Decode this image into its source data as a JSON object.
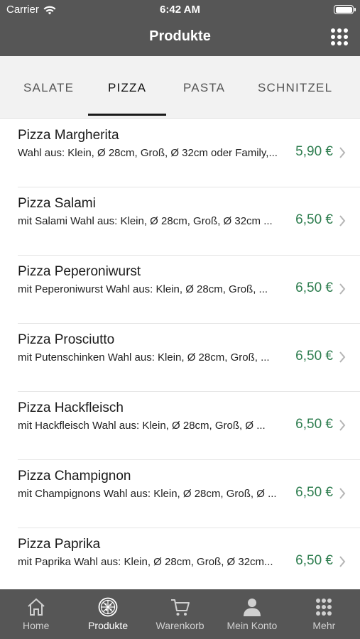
{
  "status": {
    "carrier": "Carrier",
    "time": "6:42 AM"
  },
  "nav": {
    "title": "Produkte",
    "menu_icon": "grid-icon"
  },
  "tabs": [
    {
      "label": "SALATE",
      "active": false
    },
    {
      "label": "PIZZA",
      "active": true
    },
    {
      "label": "PASTA",
      "active": false
    },
    {
      "label": "SCHNITZEL",
      "active": false
    }
  ],
  "items": [
    {
      "title": "Pizza Margherita",
      "desc": "Wahl aus: Klein, Ø 28cm, Groß, Ø 32cm oder Family,...",
      "price": "5,90 €"
    },
    {
      "title": "Pizza Salami",
      "desc": "mit Salami Wahl aus: Klein, Ø 28cm, Groß, Ø 32cm ...",
      "price": "6,50 €"
    },
    {
      "title": "Pizza Peperoniwurst",
      "desc": "mit Peperoniwurst Wahl aus: Klein, Ø 28cm, Groß, ...",
      "price": "6,50 €"
    },
    {
      "title": "Pizza Prosciutto",
      "desc": "mit Putenschinken Wahl aus: Klein, Ø 28cm, Groß, ...",
      "price": "6,50 €"
    },
    {
      "title": "Pizza Hackfleisch",
      "desc": "mit Hackfleisch Wahl aus: Klein, Ø 28cm, Groß, Ø ...",
      "price": "6,50 €"
    },
    {
      "title": "Pizza Champignon",
      "desc": "mit Champignons Wahl aus: Klein, Ø 28cm, Groß, Ø ...",
      "price": "6,50 €"
    },
    {
      "title": "Pizza Paprika",
      "desc": "mit Paprika Wahl aus: Klein, Ø 28cm, Groß, Ø 32cm...",
      "price": "6,50 €"
    }
  ],
  "tabbar": [
    {
      "label": "Home",
      "icon": "home-icon",
      "active": false
    },
    {
      "label": "Produkte",
      "icon": "pizza-icon",
      "active": true
    },
    {
      "label": "Warenkorb",
      "icon": "cart-icon",
      "active": false
    },
    {
      "label": "Mein Konto",
      "icon": "user-icon",
      "active": false
    },
    {
      "label": "Mehr",
      "icon": "grid-icon",
      "active": false
    }
  ],
  "colors": {
    "bar": "#565656",
    "price": "#2e7d4f",
    "tabs_bg": "#f2f2f2"
  }
}
